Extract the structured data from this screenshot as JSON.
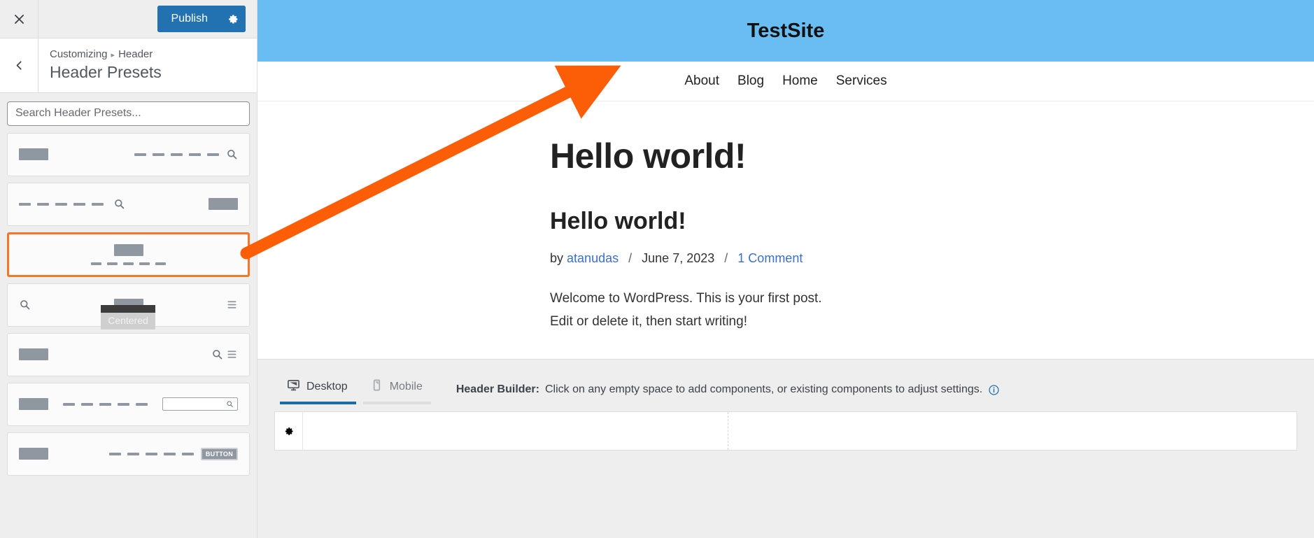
{
  "customizer": {
    "close_label": "Close",
    "publish_label": "Publish",
    "gear_label": "Publish settings",
    "back_label": "Back",
    "breadcrumb_root": "Customizing",
    "breadcrumb_sep": "▸",
    "breadcrumb_current": "Header",
    "panel_title": "Header Presets",
    "search_placeholder": "Search Header Presets...",
    "search_value": "",
    "selected_preset_tooltip": "Centered",
    "accent_selected": "#f4762a",
    "publish_color": "#2271b1",
    "presets": [
      {
        "id": "logo-left-menu-right-search",
        "layout": "logo-left",
        "menu_dashes": 5,
        "has_search": true,
        "has_burger": false,
        "has_searchbox": false,
        "has_button": false,
        "selected": false
      },
      {
        "id": "menu-left-search-logo-right",
        "layout": "menu-left",
        "menu_dashes": 5,
        "has_search": true,
        "has_burger": false,
        "has_searchbox": false,
        "has_button": false,
        "selected": false
      },
      {
        "id": "centered",
        "layout": "centered",
        "menu_dashes": 5,
        "has_search": false,
        "has_burger": false,
        "has_searchbox": false,
        "has_button": false,
        "selected": true
      },
      {
        "id": "search-left-logo-center-burger",
        "layout": "split-center",
        "menu_dashes": 0,
        "has_search": true,
        "has_burger": true,
        "has_searchbox": false,
        "has_button": false,
        "selected": false
      },
      {
        "id": "logo-left-search-burger-right",
        "layout": "logo-left",
        "menu_dashes": 0,
        "has_search": true,
        "has_burger": true,
        "has_searchbox": false,
        "has_button": false,
        "selected": false
      },
      {
        "id": "logo-menu-searchbox",
        "layout": "logo-menu-box",
        "menu_dashes": 5,
        "has_search": false,
        "has_burger": false,
        "has_searchbox": true,
        "has_button": false,
        "selected": false
      },
      {
        "id": "logo-left-menu-button-right",
        "layout": "logo-left",
        "menu_dashes": 5,
        "has_search": false,
        "has_burger": false,
        "has_searchbox": false,
        "has_button": true,
        "button_label": "BUTTON",
        "selected": false
      }
    ]
  },
  "preview": {
    "site_title": "TestSite",
    "header_bg": "#69bdf2",
    "nav": [
      {
        "label": "About"
      },
      {
        "label": "Blog"
      },
      {
        "label": "Home"
      },
      {
        "label": "Services"
      }
    ],
    "page_heading": "Hello world!",
    "post_title": "Hello world!",
    "meta_by": "by",
    "meta_author": "atanudas",
    "meta_sep": "/",
    "meta_date": "June 7, 2023",
    "meta_comments": "1 Comment",
    "post_excerpt": "Welcome to WordPress. This is your first post. Edit or delete it, then start writing!"
  },
  "builder": {
    "tabs": [
      {
        "id": "desktop",
        "label": "Desktop",
        "icon": "monitor-icon",
        "active": true
      },
      {
        "id": "mobile",
        "label": "Mobile",
        "icon": "phone-icon",
        "active": false
      }
    ],
    "hint_label": "Header Builder:",
    "hint_text": "Click on any empty space to add components, or existing components to adjust settings.",
    "info_icon": "info-icon",
    "row_gear_icon": "gear-icon"
  },
  "annotation": {
    "type": "arrow",
    "color": "#fb5e07",
    "from_label": "selected-preset-centered",
    "to_label": "site-nav-area"
  }
}
